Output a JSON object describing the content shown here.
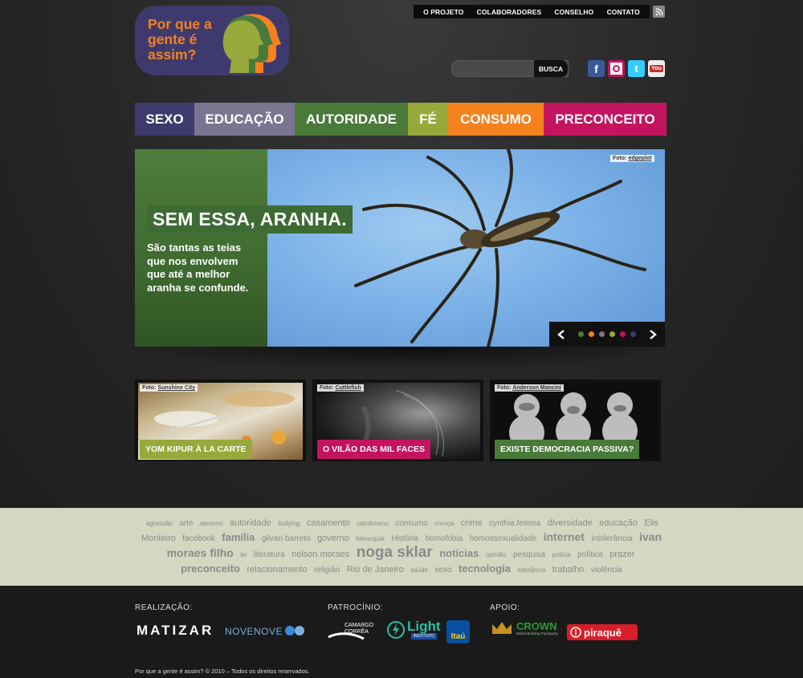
{
  "logo": {
    "text": "Por que a gente é assim?"
  },
  "top_menu": [
    "O PROJETO",
    "COLABORADORES",
    "CONSELHO",
    "CONTATO"
  ],
  "search": {
    "placeholder": "",
    "button": "BUSCA"
  },
  "nav": [
    {
      "label": "SEXO",
      "color": "#3f3a6e"
    },
    {
      "label": "EDUCAÇÃO",
      "color": "#7b7590"
    },
    {
      "label": "AUTORIDADE",
      "color": "#4a7a3a"
    },
    {
      "label": "FÉ",
      "color": "#97a93b"
    },
    {
      "label": "CONSUMO",
      "color": "#f5821f"
    },
    {
      "label": "PRECONCEITO",
      "color": "#c4145f"
    }
  ],
  "hero": {
    "title": "SEM ESSA, ARANHA.",
    "description": "São tantas as teias que nos envolvem que até a melhor aranha se confunde.",
    "credit_prefix": "Foto:",
    "credit_name": "edgeplot",
    "dot_colors": [
      "#4a7a3a",
      "#f5821f",
      "#7b7590",
      "#97a93b",
      "#c4145f",
      "#3f3a6e"
    ]
  },
  "thumbs": [
    {
      "label": "YOM KIPUR À LA CARTE",
      "credit_prefix": "Foto:",
      "credit_name": "Sunshine City",
      "color": "#97a93b"
    },
    {
      "label": "O VILÃO DAS MIL FACES",
      "credit_prefix": "Foto:",
      "credit_name": "Cuttlefish",
      "color": "#c4145f"
    },
    {
      "label": "EXISTE DEMOCRACIA PASSIVA?",
      "credit_prefix": "Foto:",
      "credit_name": "Anderson Mancini",
      "color": "#4a7a3a"
    }
  ],
  "tags": [
    {
      "t": "agressão",
      "s": 1
    },
    {
      "t": "arte",
      "s": 2
    },
    {
      "t": "ateísmo",
      "s": 1
    },
    {
      "t": "autoridade",
      "s": 3
    },
    {
      "t": "bullying",
      "s": 1
    },
    {
      "t": "casamento",
      "s": 3
    },
    {
      "t": "catolicismo",
      "s": 1
    },
    {
      "t": "consumo",
      "s": 2
    },
    {
      "t": "crença",
      "s": 1
    },
    {
      "t": "crime",
      "s": 3
    },
    {
      "t": "cynthia feitosa",
      "s": 2
    },
    {
      "t": "diversidade",
      "s": 3
    },
    {
      "t": "educação",
      "s": 3
    },
    {
      "t": "Elis Monteiro",
      "s": 3
    },
    {
      "t": "facebook",
      "s": 2
    },
    {
      "t": "família",
      "s": 4
    },
    {
      "t": "gilvan barreto",
      "s": 2
    },
    {
      "t": "governo",
      "s": 3
    },
    {
      "t": "hierarquia",
      "s": 1
    },
    {
      "t": "História",
      "s": 2
    },
    {
      "t": "homofobia",
      "s": 2
    },
    {
      "t": "homossexualidade",
      "s": 2
    },
    {
      "t": "internet",
      "s": 5
    },
    {
      "t": "intolerância",
      "s": 2
    },
    {
      "t": "ivan moraes filho",
      "s": 5
    },
    {
      "t": "lei",
      "s": 1
    },
    {
      "t": "literatura",
      "s": 2
    },
    {
      "t": "nelson moraes",
      "s": 3
    },
    {
      "t": "noga sklar",
      "s": 6
    },
    {
      "t": "notícias",
      "s": 4
    },
    {
      "t": "opinião",
      "s": 1
    },
    {
      "t": "pesquisa",
      "s": 2
    },
    {
      "t": "polícia",
      "s": 1
    },
    {
      "t": "política",
      "s": 2
    },
    {
      "t": "prazer",
      "s": 3
    },
    {
      "t": "preconceito",
      "s": 4
    },
    {
      "t": "relacionamento",
      "s": 3
    },
    {
      "t": "religião",
      "s": 2
    },
    {
      "t": "Rio de Janeiro",
      "s": 3
    },
    {
      "t": "saúde",
      "s": 1
    },
    {
      "t": "sexo",
      "s": 2
    },
    {
      "t": "tecnologia",
      "s": 4
    },
    {
      "t": "tolerância",
      "s": 1
    },
    {
      "t": "trabalho",
      "s": 3
    },
    {
      "t": "violência",
      "s": 2
    }
  ],
  "footer": {
    "realizacao": "REALIZAÇÃO:",
    "patrocinio": "PATROCÍNIO:",
    "apoio": "APOIO:",
    "logos": {
      "matizar": "MATIZAR",
      "novenove": "NOVENOVE",
      "camargo": "CAMARGO CORRÊA",
      "light": "Light",
      "light_sub": "INSTITUTO",
      "itau": "Itaú",
      "crown": "CROWN",
      "crown_sub": "Brand-Building Packaging",
      "piraque": "piraquê"
    },
    "copyright": "Por que a gente é assim? © 2010 – Todos os direitos reservados."
  }
}
